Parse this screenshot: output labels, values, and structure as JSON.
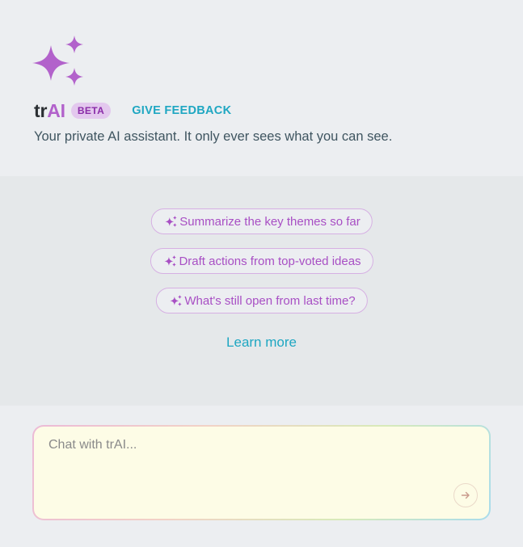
{
  "header": {
    "brand_prefix": "tr",
    "brand_suffix": "AI",
    "badge": "BETA",
    "feedback_label": "GIVE FEEDBACK",
    "tagline": "Your private AI assistant. It only ever sees what you can see."
  },
  "suggestions": [
    {
      "label": "Summarize the key themes so far",
      "icon": "sparkle-icon"
    },
    {
      "label": "Draft actions from top-voted ideas",
      "icon": "sparkle-icon"
    },
    {
      "label": "What's still open from last time?",
      "icon": "sparkle-icon"
    }
  ],
  "learn_more": "Learn more",
  "composer": {
    "placeholder": "Chat with trAI...",
    "value": "",
    "send_icon": "arrow-right-icon"
  },
  "colors": {
    "accent_purple": "#b262cb",
    "accent_teal": "#1fa7c2",
    "badge_bg": "#e3c8ee",
    "input_bg": "#fdfce6"
  }
}
